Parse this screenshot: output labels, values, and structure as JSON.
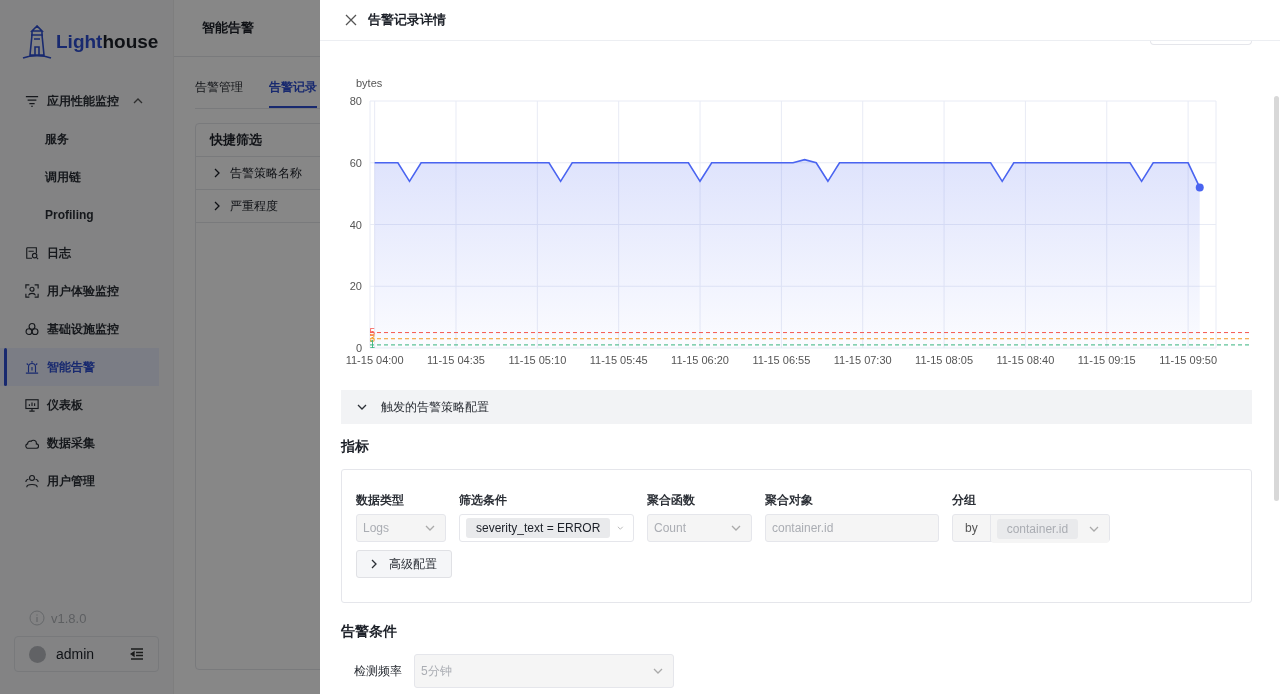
{
  "sidebar": {
    "logo": {
      "text_1": "Light",
      "text_2": "house"
    },
    "items": [
      {
        "label": "应用性能监控",
        "selected": false,
        "expanded": true,
        "children": [
          {
            "label": "服务",
            "selected": false
          },
          {
            "label": "调用链",
            "selected": false
          },
          {
            "label": "Profiling",
            "selected": false
          }
        ]
      },
      {
        "label": "日志",
        "selected": false
      },
      {
        "label": "用户体验监控",
        "selected": false
      },
      {
        "label": "基础设施监控",
        "selected": false
      },
      {
        "label": "智能告警",
        "selected": true
      },
      {
        "label": "仪表板",
        "selected": false
      },
      {
        "label": "数据采集",
        "selected": false
      },
      {
        "label": "用户管理",
        "selected": false
      }
    ],
    "version": "v1.8.0",
    "user": "admin"
  },
  "page": {
    "title": "智能告警",
    "tabs": [
      {
        "label": "告警管理",
        "selected": false
      },
      {
        "label": "告警记录",
        "selected": true
      }
    ],
    "quick_filter": {
      "title": "快捷筛选",
      "items": [
        {
          "label": "告警策略名称",
          "expanded": false
        },
        {
          "label": "严重程度",
          "expanded": false
        }
      ]
    }
  },
  "drawer": {
    "title": "告警记录详情",
    "chart_data": {
      "type": "area",
      "ylabel": "bytes",
      "ylim": [
        0,
        80
      ],
      "yticks": [
        0,
        20,
        40,
        60,
        80
      ],
      "categories": [
        "11-15 04:00",
        null,
        null,
        null,
        null,
        null,
        null,
        "11-15 04:35",
        null,
        null,
        null,
        null,
        null,
        null,
        "11-15 05:10",
        null,
        null,
        null,
        null,
        null,
        null,
        "11-15 05:45",
        null,
        null,
        null,
        null,
        null,
        null,
        "11-15 06:20",
        null,
        null,
        null,
        null,
        null,
        null,
        "11-15 06:55",
        null,
        null,
        null,
        null,
        null,
        null,
        "11-15 07:30",
        null,
        null,
        null,
        null,
        null,
        null,
        "11-15 08:05",
        null,
        null,
        null,
        null,
        null,
        null,
        "11-15 08:40",
        null,
        null,
        null,
        null,
        null,
        null,
        "11-15 09:15",
        null,
        null,
        null,
        null,
        null,
        null,
        "11-15 09:50",
        null
      ],
      "series": [
        {
          "color": "#4a64f0",
          "values": [
            60,
            60,
            60,
            54,
            60,
            60,
            60,
            60,
            60,
            60,
            60,
            60,
            60,
            60,
            60,
            60,
            54,
            60,
            60,
            60,
            60,
            60,
            60,
            60,
            60,
            60,
            60,
            60,
            54,
            60,
            60,
            60,
            60,
            60,
            60,
            60,
            60,
            61,
            60,
            54,
            60,
            60,
            60,
            60,
            60,
            60,
            60,
            60,
            60,
            60,
            60,
            60,
            60,
            60,
            54,
            60,
            60,
            60,
            60,
            60,
            60,
            60,
            60,
            60,
            60,
            60,
            54,
            60,
            60,
            60,
            60,
            52
          ]
        }
      ],
      "grid": true,
      "ref_lines": [
        {
          "axis": "y",
          "value": 5,
          "label": "5",
          "color": "#f5574f"
        },
        {
          "axis": "y",
          "value": 3,
          "label": "3",
          "color": "#f59a23"
        },
        {
          "axis": "y",
          "value": 1,
          "label": "1",
          "color": "#36b37e"
        }
      ]
    },
    "section": {
      "title": "触发的告警策略配置",
      "expanded": true
    },
    "metrics": {
      "title": "指标",
      "fields": [
        {
          "kind": "select",
          "label": "数据类型",
          "value": "Logs",
          "disabled": true
        },
        {
          "kind": "tags",
          "label": "筛选条件",
          "tags": [
            "severity_text = ERROR"
          ],
          "disabled": false
        },
        {
          "kind": "select",
          "label": "聚合函数",
          "value": "Count",
          "disabled": true
        },
        {
          "kind": "input",
          "label": "聚合对象",
          "value": "container.id",
          "disabled": true
        },
        {
          "kind": "group",
          "label": "分组",
          "addon": "by",
          "tags": [
            "container.id"
          ],
          "disabled": true
        }
      ],
      "advanced_button": "高级配置"
    },
    "conditions": {
      "title": "告警条件",
      "fields": [
        {
          "kind": "select",
          "label": "检测频率",
          "value": "5分钟",
          "disabled": true
        }
      ]
    }
  }
}
